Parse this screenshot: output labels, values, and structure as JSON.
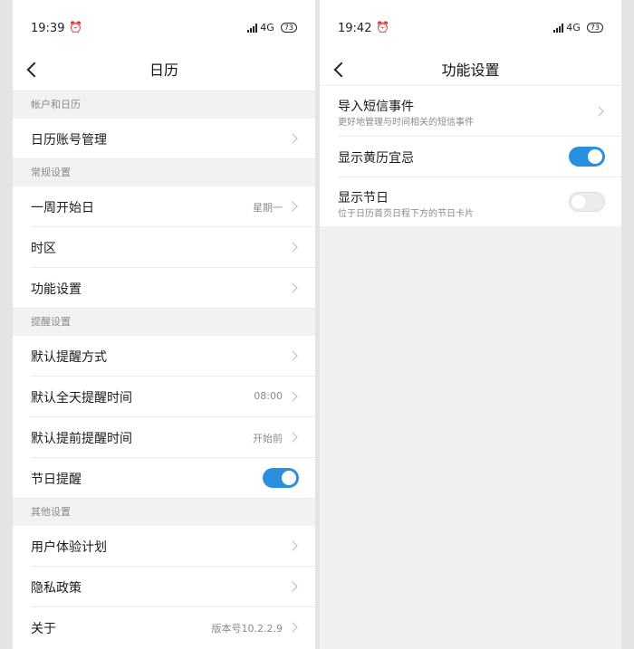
{
  "left_screen": {
    "status": {
      "time": "19:39",
      "network": "4G",
      "battery": "73"
    },
    "title": "日历",
    "sections": [
      {
        "header": "帐户和日历",
        "items": [
          {
            "label": "日历账号管理",
            "value": ""
          }
        ]
      },
      {
        "header": "常规设置",
        "items": [
          {
            "label": "一周开始日",
            "value": "星期一"
          },
          {
            "label": "时区",
            "value": ""
          },
          {
            "label": "功能设置",
            "value": ""
          }
        ]
      },
      {
        "header": "提醒设置",
        "items": [
          {
            "label": "默认提醒方式",
            "value": ""
          },
          {
            "label": "默认全天提醒时间",
            "value": "08:00"
          },
          {
            "label": "默认提前提醒时间",
            "value": "开始前"
          },
          {
            "label": "节日提醒",
            "toggle": true
          }
        ]
      },
      {
        "header": "其他设置",
        "items": [
          {
            "label": "用户体验计划",
            "value": ""
          },
          {
            "label": "隐私政策",
            "value": ""
          },
          {
            "label": "关于",
            "value": "版本号10.2.2.9"
          }
        ]
      }
    ]
  },
  "right_screen": {
    "status": {
      "time": "19:42",
      "network": "4G",
      "battery": "73"
    },
    "title": "功能设置",
    "items": [
      {
        "title": "导入短信事件",
        "subtitle": "更好地管理与时间相关的短信事件"
      },
      {
        "title": "显示黄历宜忌",
        "toggle": true
      },
      {
        "title": "显示节日",
        "subtitle": "位于日历首页日程下方的节日卡片",
        "toggle": false
      }
    ]
  },
  "colors": {
    "accent": "#2b8fe0",
    "section_bg": "#f2f2f2",
    "secondary_text": "#8a8a8a"
  },
  "icons": {
    "back": "chevron-left-icon",
    "row_arrow": "chevron-right-icon",
    "alarm": "alarm-clock-icon",
    "signal": "signal-icon",
    "battery": "battery-icon"
  }
}
